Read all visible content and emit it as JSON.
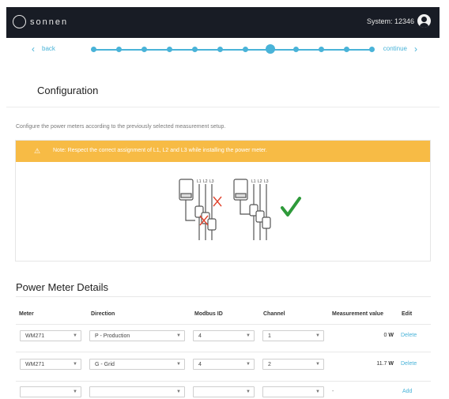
{
  "header": {
    "logo_text": "sonnen",
    "system_label": "System:",
    "system_id": "12346"
  },
  "stepper": {
    "back_label": "back",
    "continue_label": "continue",
    "active_step": 8,
    "steps": [
      1,
      2,
      3,
      4,
      5,
      6,
      7,
      8,
      9,
      10,
      11,
      12
    ]
  },
  "page": {
    "title": "Configuration",
    "intro": "Configure the power meters according to the previously selected measurement setup.",
    "note": "Note: Respect the correct assignment of L1, L2 and L3 while installing the power meter.",
    "phase_labels": [
      "L1",
      "L2",
      "L3"
    ]
  },
  "details": {
    "title": "Power Meter Details",
    "columns": {
      "meter": "Meter",
      "direction": "Direction",
      "modbus": "Modbus ID",
      "channel": "Channel",
      "measurement": "Measurement value",
      "edit": "Edit"
    },
    "rows": [
      {
        "meter": "WM271",
        "direction": "P - Production",
        "modbus": "4",
        "channel": "1",
        "value": "0",
        "unit": "W",
        "action": "Delete"
      },
      {
        "meter": "WM271",
        "direction": "G - Grid",
        "modbus": "4",
        "channel": "2",
        "value": "11.7",
        "unit": "W",
        "action": "Delete"
      }
    ],
    "new_row": {
      "meter": "",
      "direction": "",
      "modbus": "",
      "channel": "",
      "value": "-",
      "action": "Add"
    }
  },
  "colors": {
    "topbar": "#181c25",
    "accent": "#49b3d8",
    "warning": "#f7bb45",
    "check": "#2e9a3a",
    "cross": "#e0412b"
  },
  "icons": [
    "user-icon",
    "chevron-left-icon",
    "chevron-right-icon",
    "warning-icon",
    "caret-down-icon",
    "checkmark-icon",
    "cross-icon"
  ]
}
